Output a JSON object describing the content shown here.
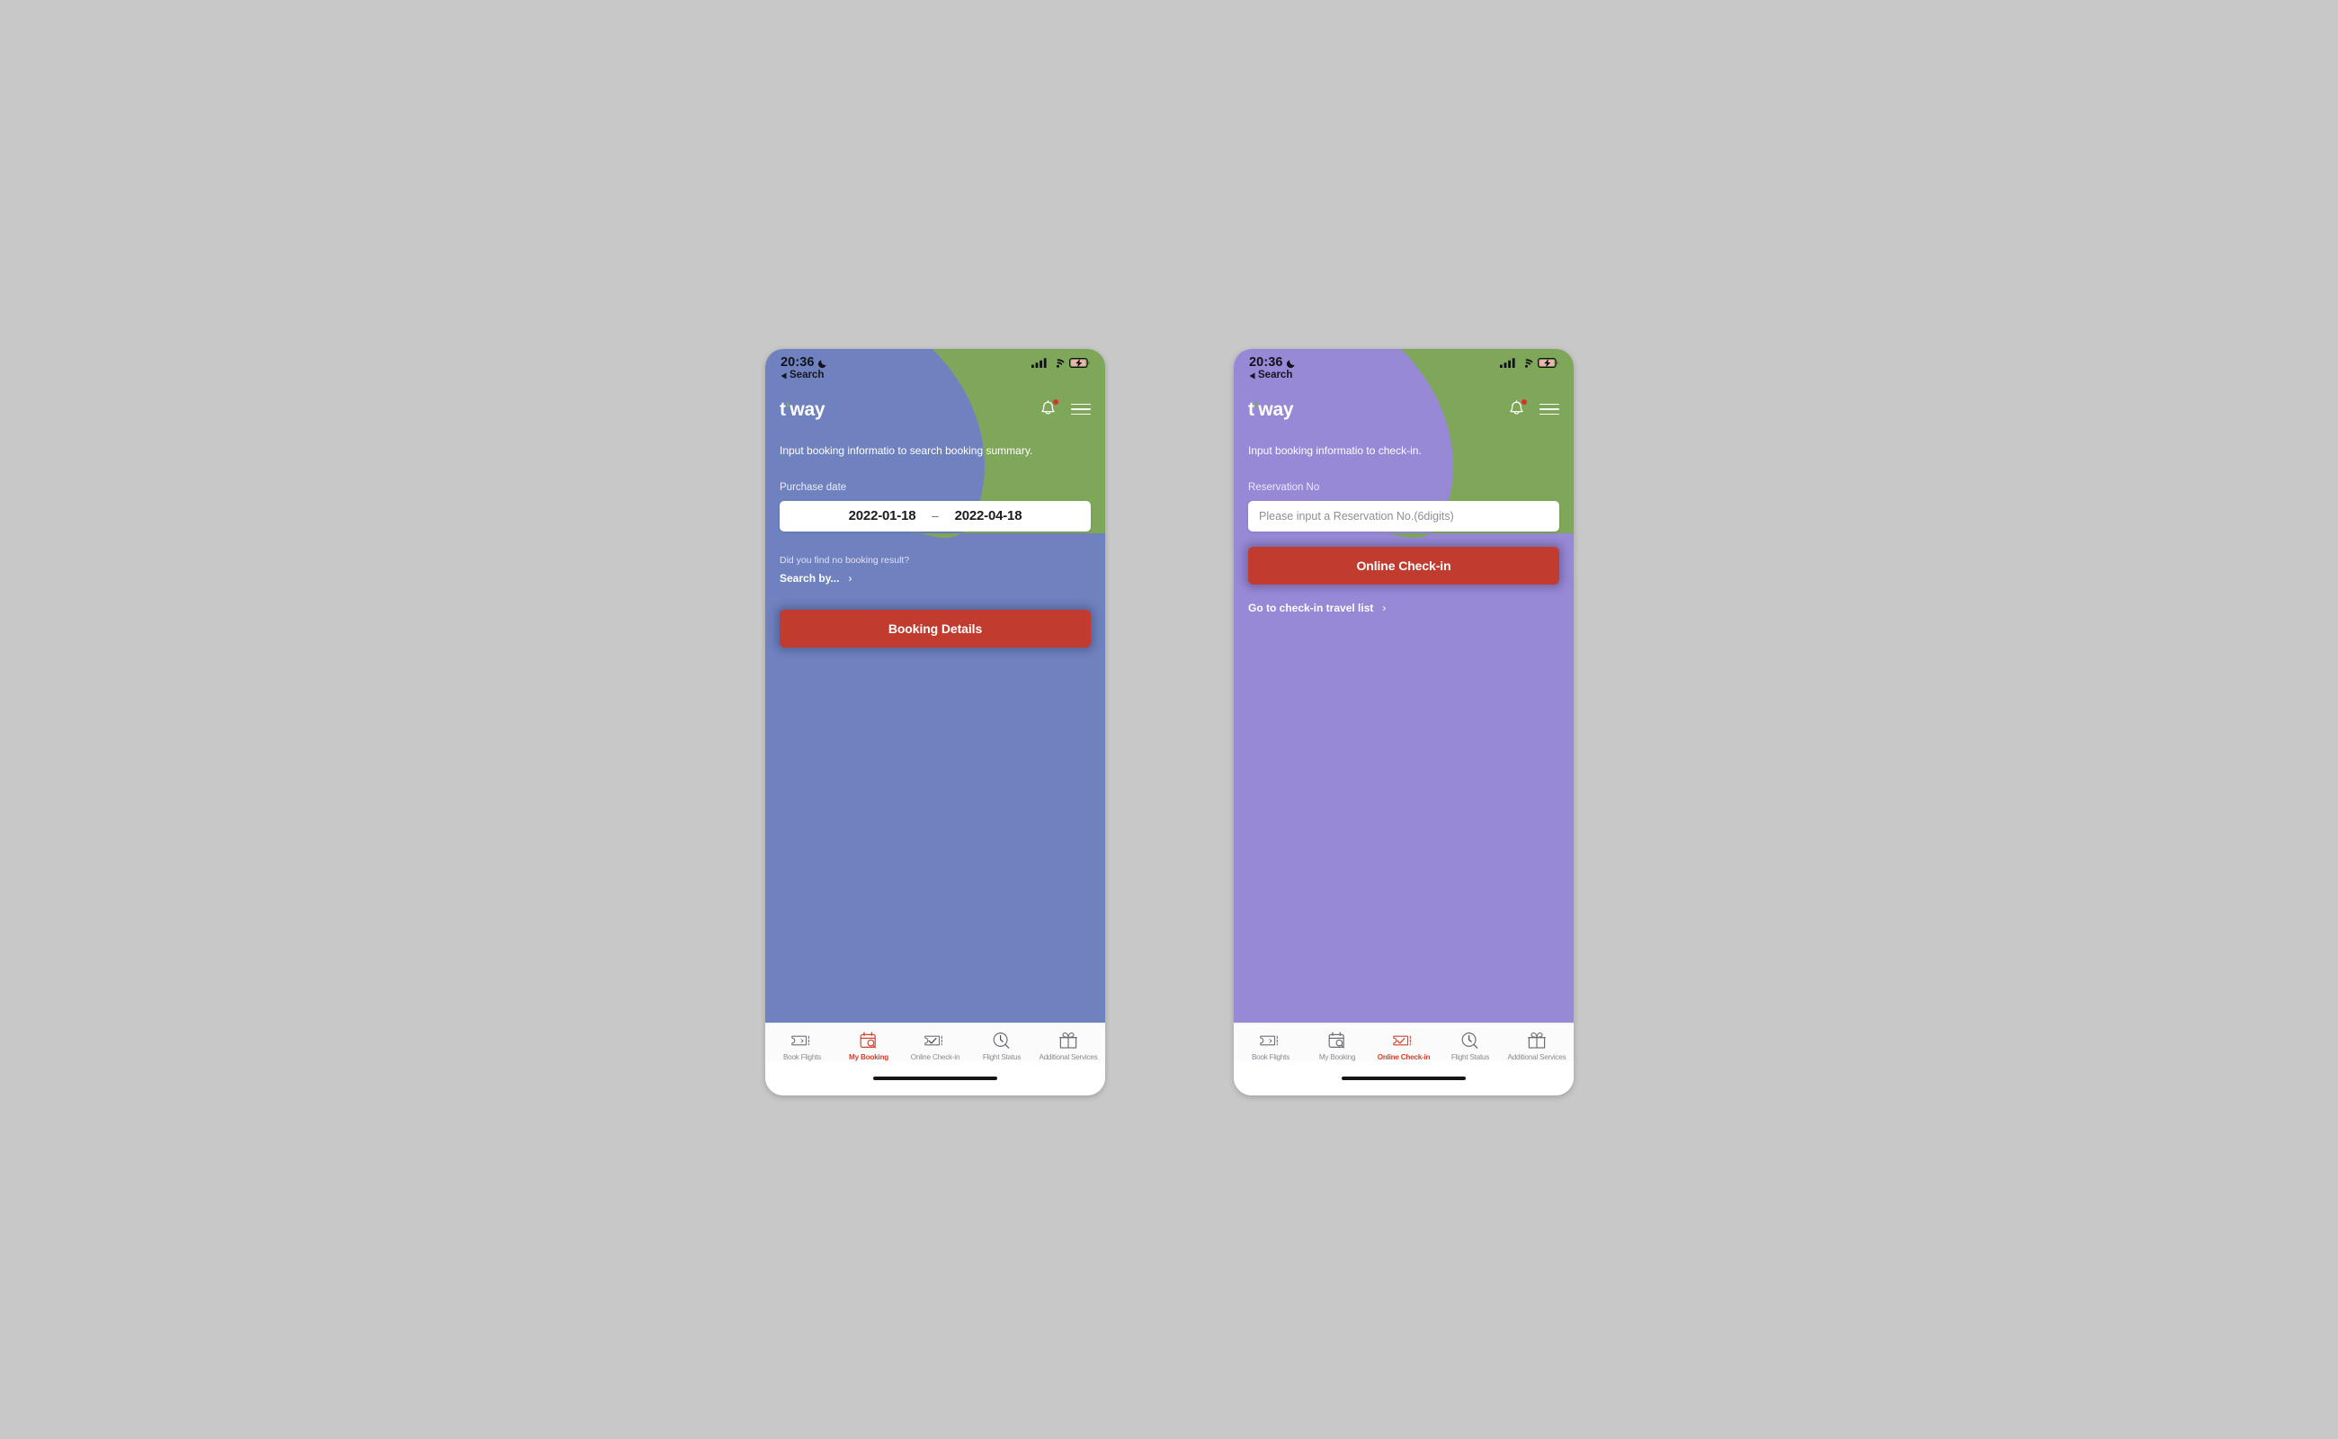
{
  "colors": {
    "page_background": "#c8c8c8",
    "phone1_background": "#6f82bf",
    "phone2_background": "#9789d6",
    "accent_green": "#7fa75a",
    "cta_red": "#c13b2e",
    "active_tab_red": "#d8402f",
    "notification_dot": "#d6342a"
  },
  "status_bar": {
    "time": "20:36",
    "moon_icon": "crescent-moon-icon",
    "back_label": "Search",
    "back_icon": "triangle-left-icon",
    "signal_icon": "cellular-signal-icon",
    "wifi_icon": "wifi-icon",
    "battery_icon": "battery-charging-icon"
  },
  "brand": {
    "logo_t": "t",
    "logo_apostrophe": "'",
    "logo_way": "way",
    "bell_icon": "notification-bell-icon",
    "menu_icon": "hamburger-menu-icon"
  },
  "tabs": [
    {
      "label": "Book Flights",
      "icon": "ticket-plane-icon",
      "active_1": false,
      "active_2": false
    },
    {
      "label": "My Booking",
      "icon": "calendar-search-icon",
      "active_1": true,
      "active_2": false
    },
    {
      "label": "Online Check-in",
      "icon": "ticket-check-icon",
      "active_1": false,
      "active_2": true
    },
    {
      "label": "Flight Status",
      "icon": "clock-search-icon",
      "active_1": false,
      "active_2": false
    },
    {
      "label": "Additional Services",
      "icon": "gift-box-icon",
      "active_1": false,
      "active_2": false
    }
  ],
  "phone1": {
    "lead": "Input booking informatio to search booking summary.",
    "purchase_date_label": "Purchase date",
    "date_from": "2022-01-18",
    "date_separator": "–",
    "date_to": "2022-04-18",
    "helper_question": "Did you find no booking result?",
    "helper_link": "Search by...",
    "helper_chevron": "›",
    "cta_label": "Booking Details"
  },
  "phone2": {
    "lead": "Input booking informatio to check-in.",
    "reservation_label": "Reservation No",
    "reservation_placeholder": "Please input a Reservation No.(6digits)",
    "reservation_value": "",
    "cta_label": "Online Check-in",
    "travel_link": "Go to check-in travel list",
    "travel_chevron": "›"
  }
}
